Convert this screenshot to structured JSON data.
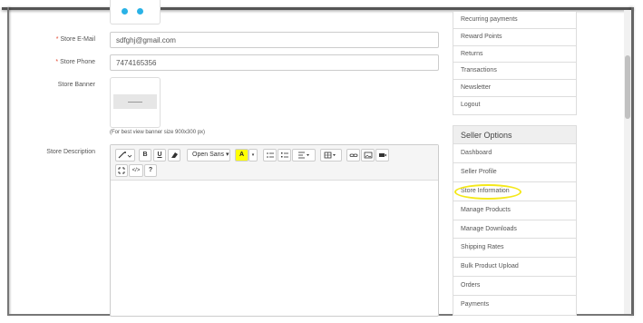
{
  "store_form": {
    "email_label": "Store E-Mail",
    "email_value": "sdfghj@gmail.com",
    "phone_label": "Store Phone",
    "phone_value": "7474165356",
    "required_mark": "*",
    "banner_label": "Store Banner",
    "banner_note": "(For best view banner size 900x300 px)",
    "description_label": "Store Description"
  },
  "editor_toolbar": {
    "magic_icon": "magic-wand-icon",
    "bold": "B",
    "underline": "U",
    "eraser_icon": "eraser-icon",
    "font_family": "Open Sans",
    "font_color": "A",
    "unordered_list_icon": "unordered-list-icon",
    "ordered_list_icon": "ordered-list-icon",
    "align_icon": "align-icon",
    "table_icon": "table-icon",
    "link_icon": "link-icon",
    "picture_icon": "picture-icon",
    "video_icon": "video-icon",
    "fullscreen_icon": "fullscreen-icon",
    "code": "</>",
    "help": "?"
  },
  "account_menu": {
    "items": [
      "Recurring payments",
      "Reward Points",
      "Returns",
      "Transactions",
      "Newsletter",
      "Logout"
    ]
  },
  "seller_options": {
    "title": "Seller Options",
    "items": [
      "Dashboard",
      "Seller Profile",
      "Store Information",
      "Manage Products",
      "Manage Downloads",
      "Shipping Rates",
      "Bulk Product Upload",
      "Orders",
      "Payments"
    ]
  },
  "colors": {
    "accent_blue": "#2ab2e6",
    "required_red": "#e2452e",
    "highlight_yellow": "#f4e81a"
  }
}
